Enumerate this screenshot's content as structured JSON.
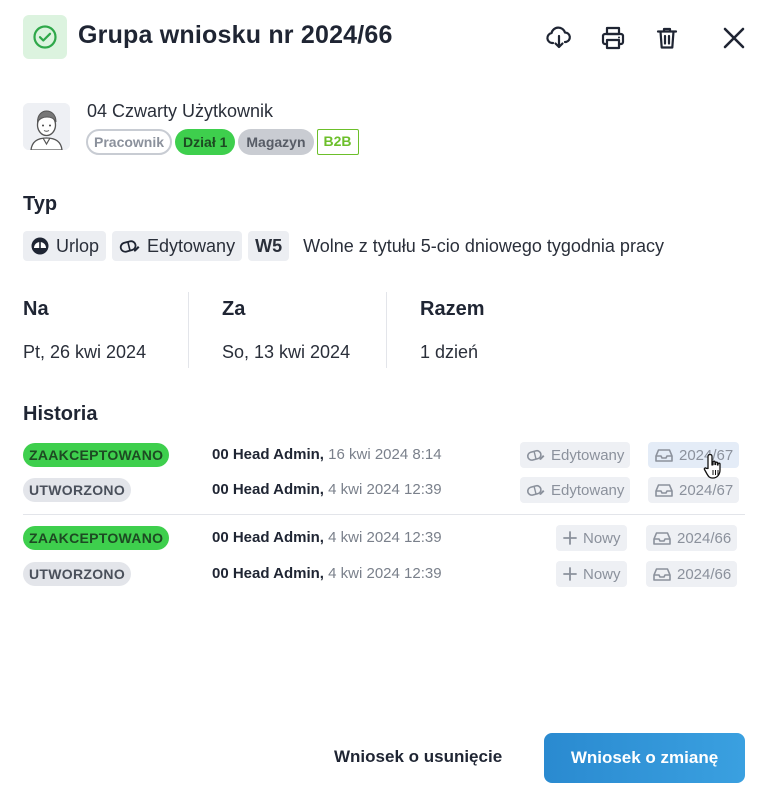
{
  "header": {
    "title": "Grupa wniosku nr 2024/66",
    "status_icon": "check-circle-icon",
    "actions": [
      "download-cloud-icon",
      "print-icon",
      "trash-icon",
      "close-icon"
    ]
  },
  "user": {
    "name": "04 Czwarty Użytkownik",
    "tags": [
      "Pracownik",
      "Dział 1",
      "Magazyn",
      "B2B"
    ]
  },
  "type_section": {
    "title": "Typ",
    "chips": {
      "leave": "Urlop",
      "edited": "Edytowany",
      "code": "W5"
    },
    "description": "Wolne z tytułu 5-cio dniowego tygodnia pracy"
  },
  "dates": {
    "from_label": "Na",
    "from_value": "Pt, 26 kwi 2024",
    "to_label": "Za",
    "to_value": "So, 13 kwi 2024",
    "total_label": "Razem",
    "total_value": "1 dzień"
  },
  "history": {
    "title": "Historia",
    "rows": [
      {
        "status": "ZAAKCEPTOWANO",
        "actor": "00 Head Admin,",
        "time": " 16 kwi 2024 8:14",
        "action": "Edytowany",
        "ref": "2024/67"
      },
      {
        "status": "UTWORZONO",
        "actor": "00 Head Admin,",
        "time": " 4 kwi 2024 12:39",
        "action": "Edytowany",
        "ref": "2024/67"
      },
      {
        "status": "ZAAKCEPTOWANO",
        "actor": "00 Head Admin,",
        "time": " 4 kwi 2024 12:39",
        "action": "Nowy",
        "ref": "2024/66"
      },
      {
        "status": "UTWORZONO",
        "actor": "00 Head Admin,",
        "time": " 4 kwi 2024 12:39",
        "action": "Nowy",
        "ref": "2024/66"
      }
    ]
  },
  "footer": {
    "delete_request": "Wniosek o usunięcie",
    "change_request": "Wniosek o zmianę"
  },
  "colors": {
    "accent": "#2a8ad0",
    "success": "#3ecf4d",
    "b2b": "#6cbf2a"
  }
}
